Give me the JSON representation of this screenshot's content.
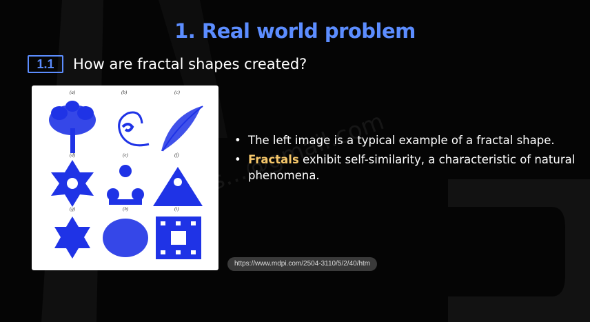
{
  "slide": {
    "title": "1. Real world problem",
    "section_number": "1.1",
    "section_heading": "How are fractal shapes created?"
  },
  "figure": {
    "labels": [
      "(a)",
      "(b)",
      "(c)",
      "(d)",
      "(e)",
      "(f)",
      "(g)",
      "(h)",
      "(i)"
    ],
    "color": "#1f33e6"
  },
  "bullets": {
    "b1_text": "The left image is a typical example of a fractal shape.",
    "b2_highlight": "Fractals",
    "b2_text": " exhibit self-similarity, a characteristic of natural phenomena."
  },
  "source_url": "https://www.mdpi.com/2504-3110/5/2/40/htm",
  "watermark": "s…@gmail.com",
  "colors": {
    "accent": "#5c8dff",
    "highlight": "#f6c76a",
    "background": "#050505"
  }
}
